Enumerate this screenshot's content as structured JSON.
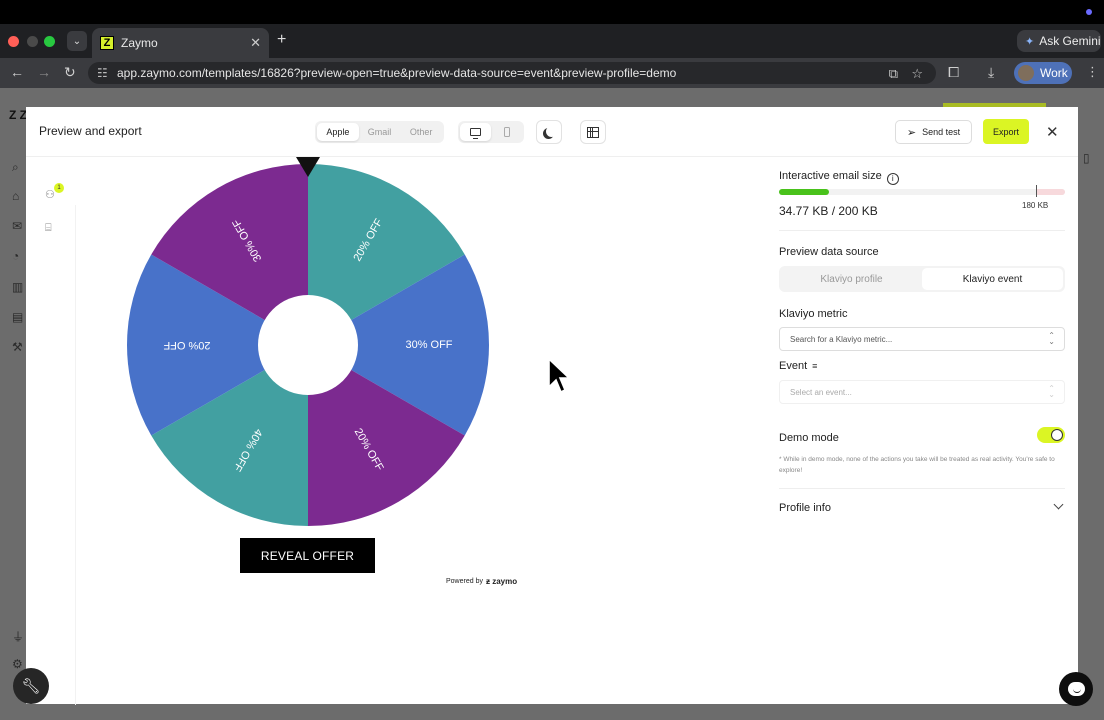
{
  "browser": {
    "tab_title": "Zaymo",
    "tab_favicon": "Z",
    "url": "app.zaymo.com/templates/16826?preview-open=true&preview-data-source=event&preview-profile=demo",
    "gemini_label": "Ask Gemini",
    "profile_label": "Work"
  },
  "app": {
    "logo": "Z Z"
  },
  "modal": {
    "title": "Preview and export",
    "clients": [
      "Apple",
      "Gmail",
      "Other"
    ],
    "active_client": "Apple",
    "send_test_label": "Send test",
    "export_label": "Export",
    "rail_badge": "1"
  },
  "wheel": {
    "segments": [
      {
        "label": "20% OFF",
        "color": "#42a0a1"
      },
      {
        "label": "30% OFF",
        "color": "#4872c9"
      },
      {
        "label": "20% OFF",
        "color": "#7c2a90"
      },
      {
        "label": "40% OFF",
        "color": "#42a0a1"
      },
      {
        "label": "20% OFF",
        "color": "#4872c9"
      },
      {
        "label": "30% OFF",
        "color": "#7c2a90"
      }
    ],
    "cta_label": "REVEAL OFFER",
    "powered_prefix": "Powered by",
    "powered_brand": "zaymo"
  },
  "panel": {
    "size_title": "Interactive email size",
    "size_value": "34.77 KB / 200 KB",
    "size_used_fraction": 0.174,
    "size_limit_label": "180 KB",
    "data_source_title": "Preview data source",
    "data_source_options": [
      "Klaviyo profile",
      "Klaviyo event"
    ],
    "data_source_active": "Klaviyo event",
    "metric_label": "Klaviyo metric",
    "metric_placeholder": "Search for a Klaviyo metric...",
    "event_label": "Event",
    "event_placeholder": "Select an event...",
    "demo_label": "Demo mode",
    "demo_on": true,
    "demo_note": "* While in demo mode, none of the actions you take will be treated as real activity. You're safe to explore!",
    "profile_info_label": "Profile info"
  },
  "colors": {
    "accent": "#dbf524",
    "size_ok": "#49c21b"
  }
}
